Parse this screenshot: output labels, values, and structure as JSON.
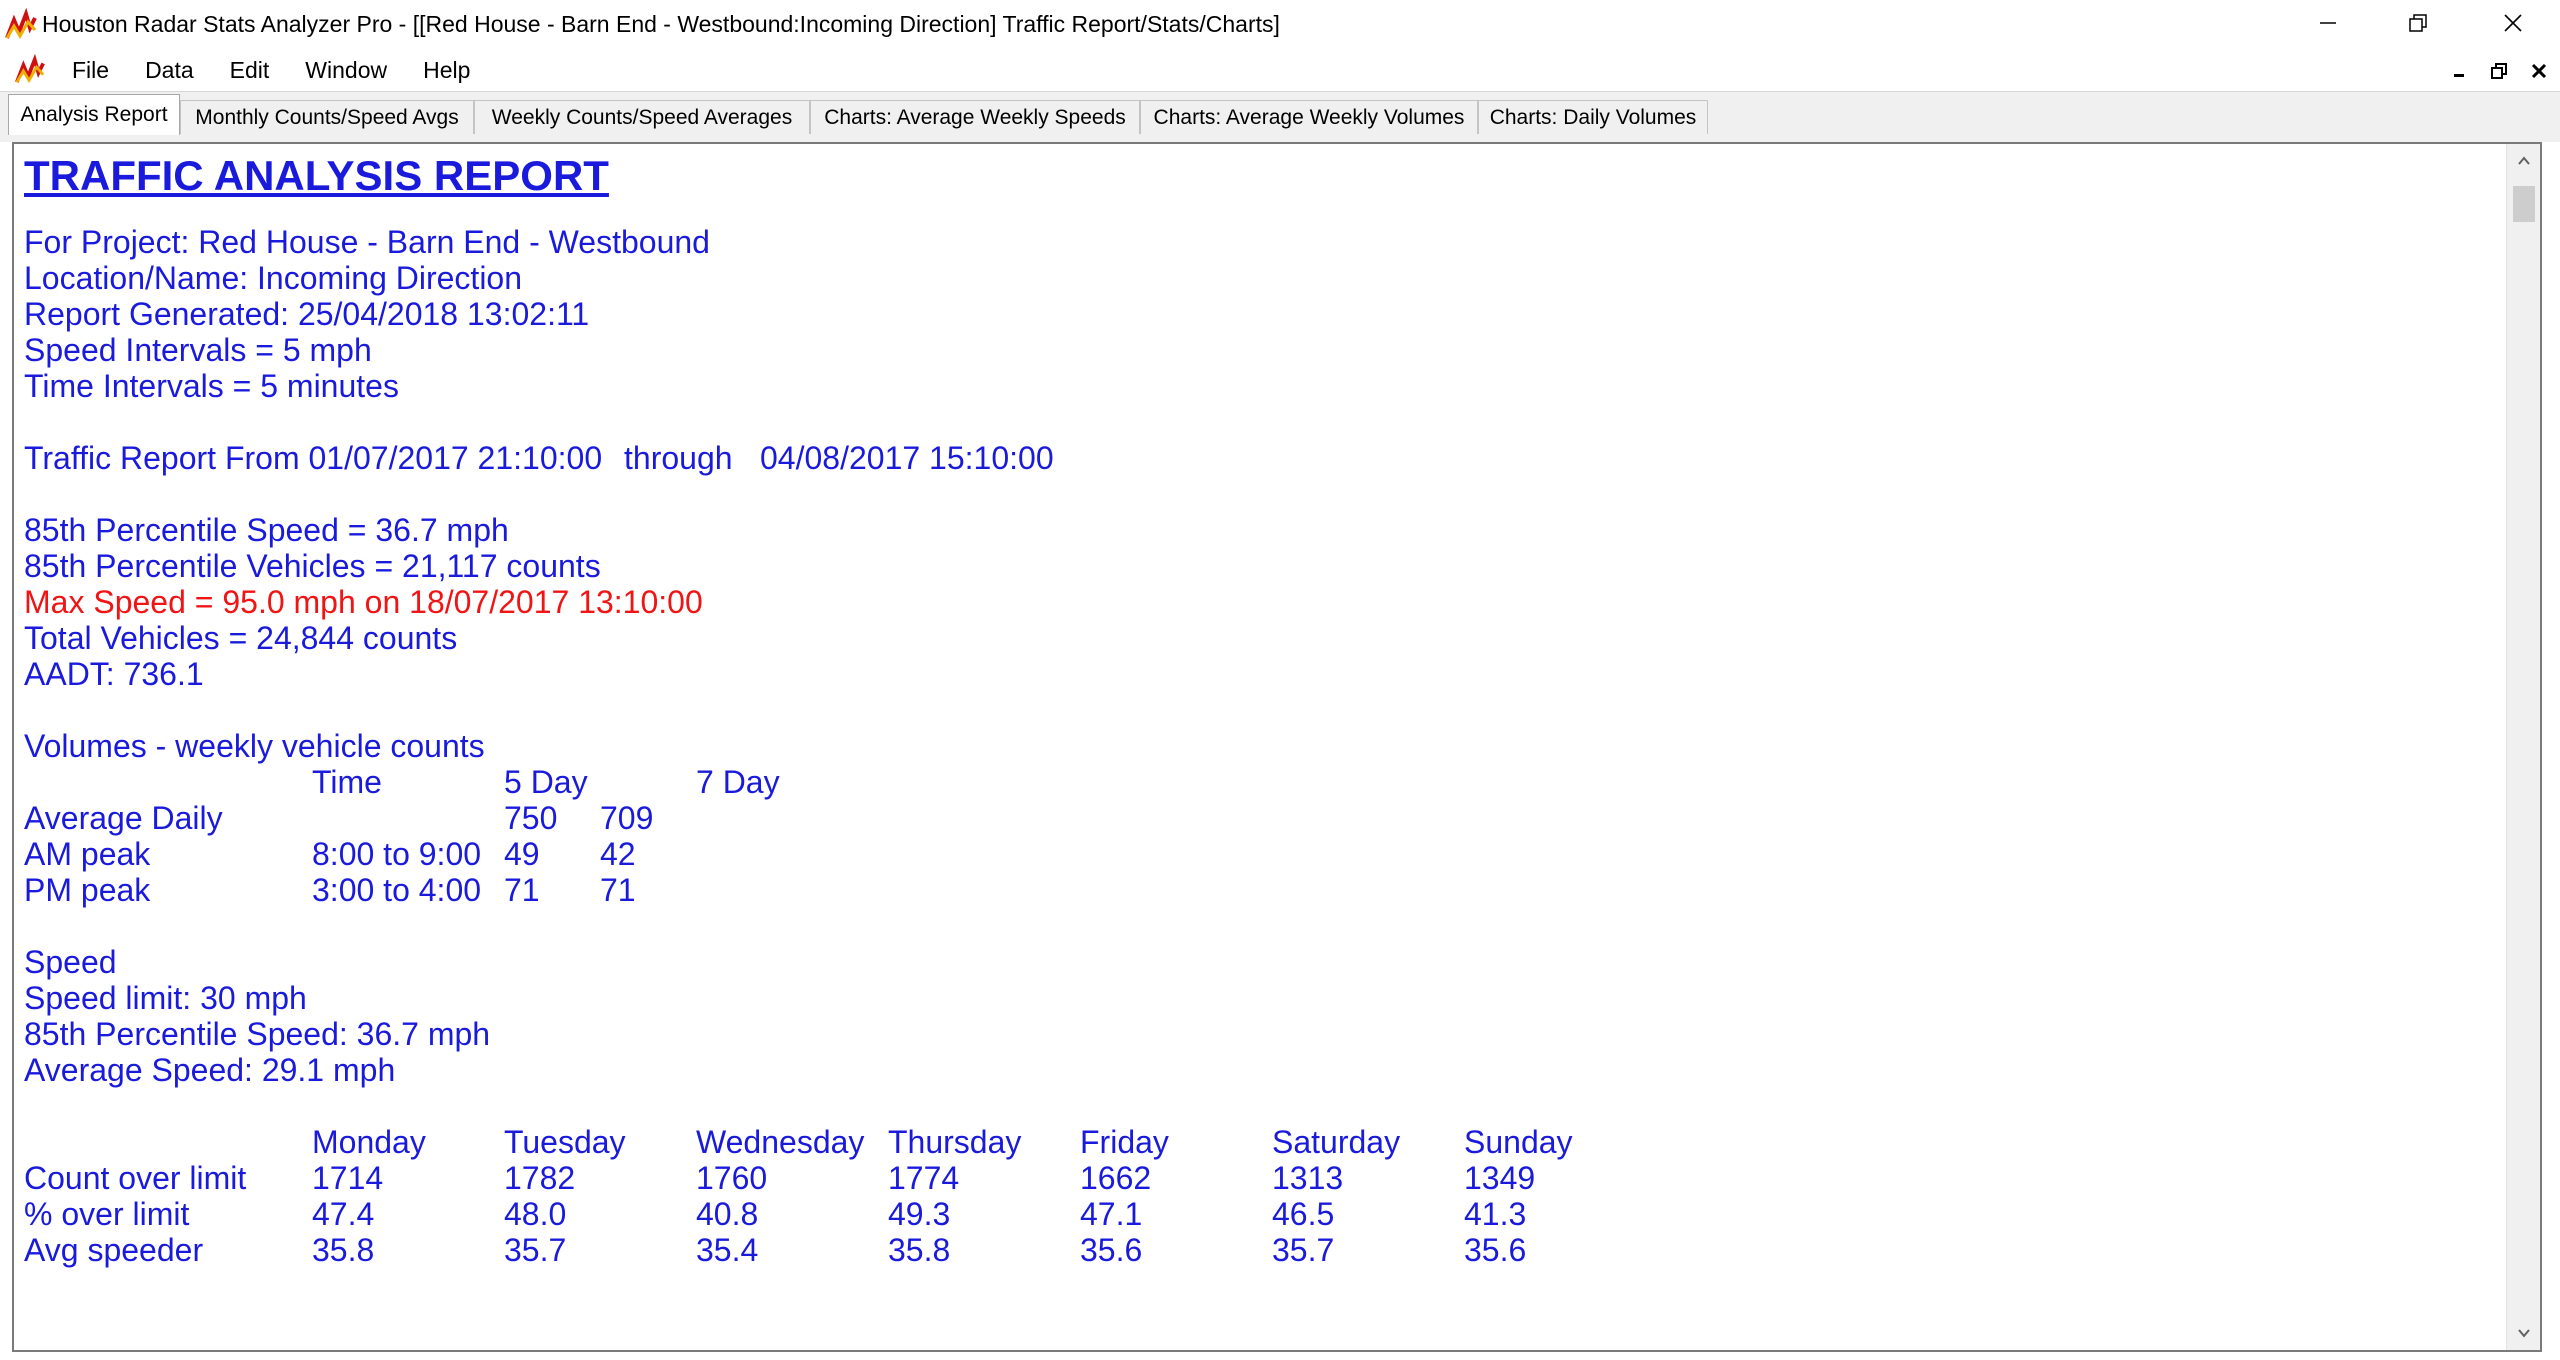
{
  "window": {
    "title": "Houston Radar Stats Analyzer Pro - [[Red House - Barn End - Westbound:Incoming Direction] Traffic Report/Stats/Charts]",
    "icon": "app-logo-icon"
  },
  "menu": [
    "File",
    "Data",
    "Edit",
    "Window",
    "Help"
  ],
  "tabs": [
    "Analysis Report",
    "Monthly Counts/Speed Avgs",
    "Weekly Counts/Speed Averages",
    "Charts: Average Weekly Speeds",
    "Charts: Average Weekly Volumes",
    "Charts: Daily Volumes"
  ],
  "active_tab": "Analysis Report",
  "report": {
    "title": "TRAFFIC ANALYSIS REPORT",
    "project": "For Project: Red House - Barn End - Westbound",
    "location": "Location/Name: Incoming Direction",
    "generated": "Report Generated: 25/04/2018 13:02:11",
    "speed_intervals": "Speed Intervals = 5 mph",
    "time_intervals": "Time Intervals = 5 minutes",
    "range": {
      "label": "Traffic Report From 01/07/2017 21:10:00",
      "through": "through",
      "end": "04/08/2017 15:10:00"
    },
    "p85_speed": "85th Percentile Speed = 36.7 mph",
    "p85_vehicles": "85th Percentile Vehicles = 21,117 counts",
    "max_speed": "Max Speed = 95.0 mph on 18/07/2017 13:10:00",
    "total_vehicles": "Total Vehicles = 24,844 counts",
    "aadt": "AADT: 736.1",
    "volumes": {
      "heading": "Volumes - weekly vehicle counts",
      "col_time": "Time",
      "col_5day": "5 Day",
      "col_7day": "7 Day",
      "rows": [
        {
          "label": "Average Daily",
          "time": "",
          "d5": "750",
          "d7": "709"
        },
        {
          "label": "AM peak",
          "time": "8:00 to 9:00",
          "d5": "49",
          "d7": "42"
        },
        {
          "label": "PM peak",
          "time": "3:00 to 4:00",
          "d5": "71",
          "d7": "71"
        }
      ]
    },
    "speed": {
      "heading": "Speed",
      "limit": "Speed limit: 30 mph",
      "p85": "85th Percentile Speed: 36.7 mph",
      "average": "Average Speed: 29.1 mph"
    },
    "weekly": {
      "days": [
        "Monday",
        "Tuesday",
        "Wednesday",
        "Thursday",
        "Friday",
        "Saturday",
        "Sunday"
      ],
      "rows": [
        {
          "label": "Count over limit",
          "values": [
            "1714",
            "1782",
            "1760",
            "1774",
            "1662",
            "1313",
            "1349"
          ]
        },
        {
          "label": "% over limit",
          "values": [
            "47.4",
            "48.0",
            "40.8",
            "49.3",
            "47.1",
            "46.5",
            "41.3"
          ]
        },
        {
          "label": "Avg speeder",
          "values": [
            "35.8",
            "35.7",
            "35.4",
            "35.8",
            "35.6",
            "35.7",
            "35.6"
          ]
        }
      ]
    }
  },
  "colors": {
    "report_text": "#1a1adc",
    "highlight": "#f01414"
  }
}
